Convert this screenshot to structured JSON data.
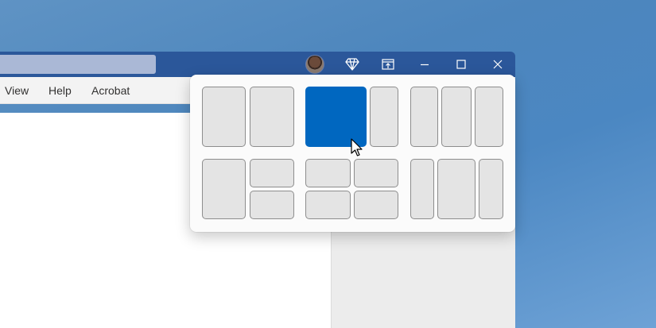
{
  "window": {
    "menu": {
      "view": "View",
      "help": "Help",
      "acrobat": "Acrobat"
    }
  },
  "icons": {
    "avatar": "user-avatar",
    "premium": "diamond-icon",
    "restore": "pin-window-icon",
    "minimize": "minimize-icon",
    "maximize": "maximize-icon",
    "close": "close-icon"
  },
  "snap_layouts": {
    "layouts": [
      {
        "name": "two-equal-columns",
        "zones": 2
      },
      {
        "name": "two-columns-wide-left",
        "zones": 2,
        "highlighted_zone": 1
      },
      {
        "name": "three-equal-columns",
        "zones": 3
      },
      {
        "name": "left-column-right-two-rows",
        "zones": 3
      },
      {
        "name": "four-quadrants",
        "zones": 4
      },
      {
        "name": "three-columns-wide-center",
        "zones": 3
      }
    ]
  },
  "colors": {
    "titlebar": "#2b579a",
    "accent": "#0067c0",
    "zone": "#e4e4e4",
    "desktop": "#4d86bd"
  }
}
